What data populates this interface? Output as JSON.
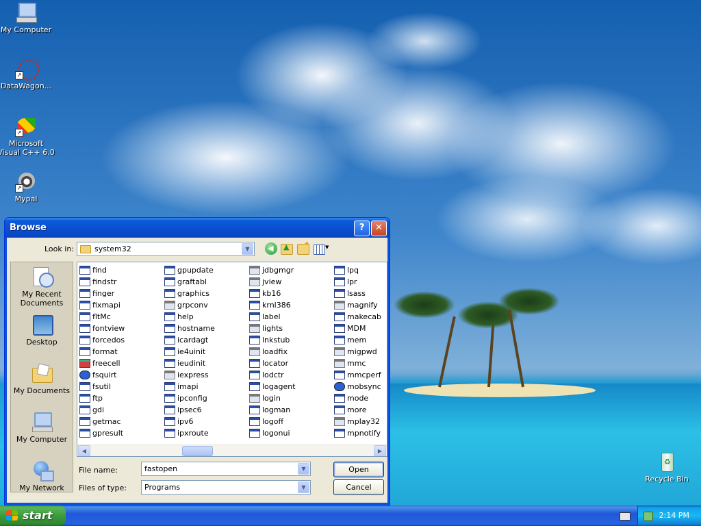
{
  "desktop": {
    "icons": [
      {
        "label": "My Computer"
      },
      {
        "label": "DataWagon..."
      },
      {
        "label": "Microsoft Visual C++ 6.0"
      },
      {
        "label": "Mypal"
      },
      {
        "label": "Recycle Bin"
      }
    ]
  },
  "dialog": {
    "title": "Browse",
    "look_in_label": "Look in:",
    "look_in_value": "system32",
    "places": [
      {
        "label": "My Recent Documents"
      },
      {
        "label": "Desktop"
      },
      {
        "label": "My Documents"
      },
      {
        "label": "My Computer"
      },
      {
        "label": "My Network"
      }
    ],
    "files": [
      [
        "find",
        "findstr",
        "finger",
        "fixmapi",
        "fltMc",
        "fontview",
        "forcedos",
        "format",
        "freecell",
        "fsquirt",
        "fsutil",
        "ftp",
        "gdi",
        "getmac",
        "gpresult"
      ],
      [
        "gpupdate",
        "graftabl",
        "graphics",
        "grpconv",
        "help",
        "hostname",
        "icardagt",
        "ie4uinit",
        "ieudinit",
        "iexpress",
        "imapi",
        "ipconfig",
        "ipsec6",
        "ipv6",
        "ipxroute"
      ],
      [
        "jdbgmgr",
        "jview",
        "kb16",
        "krnl386",
        "label",
        "lights",
        "lnkstub",
        "loadfix",
        "locator",
        "lodctr",
        "logagent",
        "login",
        "logman",
        "logoff",
        "logonui"
      ],
      [
        "lpq",
        "lpr",
        "lsass",
        "magnify",
        "makecab",
        "MDM",
        "mem",
        "migpwd",
        "mmc",
        "mmcperf",
        "mobsync",
        "mode",
        "more",
        "mplay32",
        "mpnotify"
      ]
    ],
    "file_name_label": "File name:",
    "file_name_value": "fastopen",
    "files_of_type_label": "Files of type:",
    "files_of_type_value": "Programs",
    "open_label": "Open",
    "cancel_label": "Cancel",
    "help_glyph": "?",
    "close_glyph": "✕"
  },
  "taskbar": {
    "start_label": "start",
    "clock": "2:14 PM"
  }
}
